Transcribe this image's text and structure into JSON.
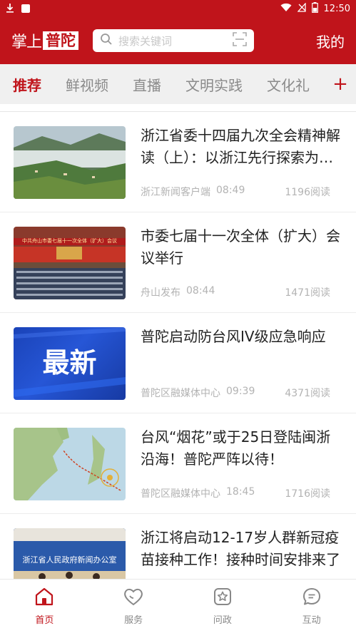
{
  "status_bar": {
    "time": "12:50"
  },
  "header": {
    "logo_part1": "掌上",
    "logo_part2": "普陀",
    "search_placeholder": "搜索关键词",
    "mine_label": "我的"
  },
  "tabs": [
    {
      "label": "推荐",
      "active": true
    },
    {
      "label": "鲜视频"
    },
    {
      "label": "直播"
    },
    {
      "label": "文明实践"
    },
    {
      "label": "文化礼"
    }
  ],
  "tab_add": "+",
  "feed": [
    {
      "title": "浙江省委十四届九次全会精神解读（上）：以浙江先行探索为全国推动共同富裕提供省域范例",
      "source": "浙江新闻客户端",
      "time": "08:49",
      "reads": "1196阅读",
      "thumb_icon": "mountain-landscape-photo"
    },
    {
      "title": "市委七届十一次全体（扩大）会议举行",
      "source": "舟山发布",
      "time": "08:44",
      "reads": "1471阅读",
      "thumb_icon": "conference-hall-photo",
      "thumb_banner": "中共舟山市委七届十一次全体（扩大）会议"
    },
    {
      "title": "普陀启动防台风IV级应急响应",
      "source": "普陀区融媒体中心",
      "time": "09:39",
      "reads": "4371阅读",
      "thumb_icon": "latest-news-banner",
      "thumb_text": "最新"
    },
    {
      "title": "台风“烟花”或于25日登陆闽浙沿海！普陀严阵以待！",
      "source": "普陀区融媒体中心",
      "time": "18:45",
      "reads": "1716阅读",
      "thumb_icon": "typhoon-track-map"
    },
    {
      "title": "浙江将启动12-17岁人群新冠疫苗接种工作！接种时间安排来了",
      "source": "",
      "time": "",
      "reads": "",
      "thumb_icon": "press-conference-photo",
      "thumb_banner": "浙江省人民政府新闻办公室"
    }
  ],
  "bottom_nav": [
    {
      "label": "首页",
      "icon": "home-icon",
      "active": true
    },
    {
      "label": "服务",
      "icon": "heart-icon"
    },
    {
      "label": "问政",
      "icon": "star-badge-icon"
    },
    {
      "label": "互动",
      "icon": "chat-icon"
    }
  ],
  "colors": {
    "brand": "#c0141b",
    "tab_bg": "#f0f0f0"
  }
}
